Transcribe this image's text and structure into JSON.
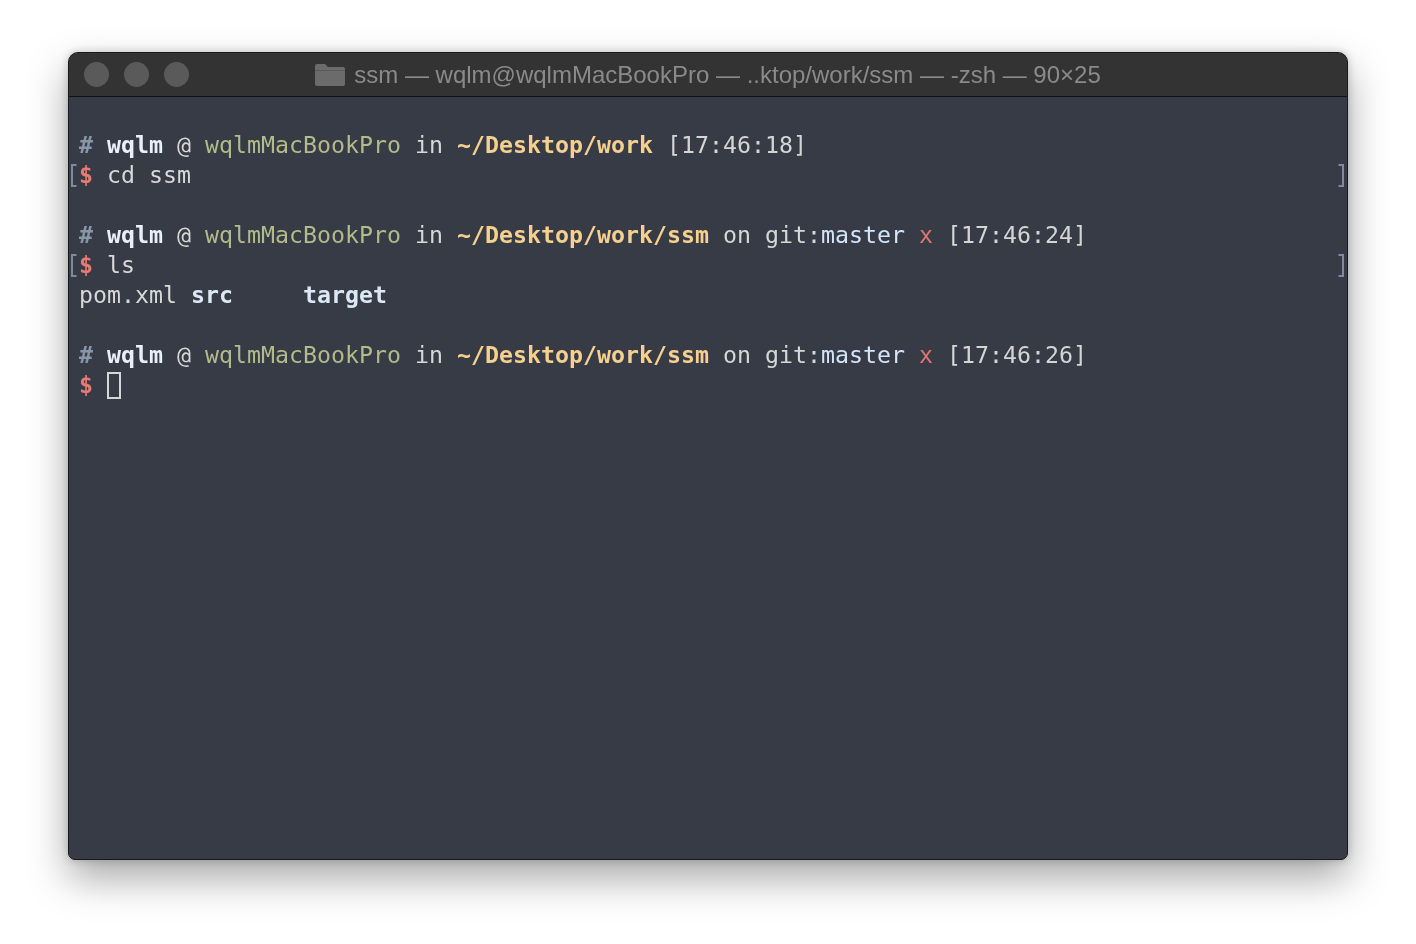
{
  "window": {
    "title": "ssm — wqlm@wqlmMacBookPro — ..ktop/work/ssm — -zsh — 90×25"
  },
  "terminal": {
    "blocks": [
      {
        "prompt": {
          "segments": [
            {
              "kind": "hash",
              "text": "#"
            },
            {
              "kind": "user",
              "text": "wqlm"
            },
            {
              "kind": "plain",
              "text": "@"
            },
            {
              "kind": "host",
              "text": "wqlmMacBookPro"
            },
            {
              "kind": "plain",
              "text": "in"
            },
            {
              "kind": "path",
              "text": "~/Desktop/work"
            },
            {
              "kind": "time",
              "text": "[17:46:18]"
            }
          ]
        },
        "command": {
          "marked": true,
          "symbol": "$",
          "text": "cd ssm",
          "cursor": false
        }
      },
      {
        "prompt": {
          "segments": [
            {
              "kind": "hash",
              "text": "#"
            },
            {
              "kind": "user",
              "text": "wqlm"
            },
            {
              "kind": "plain",
              "text": "@"
            },
            {
              "kind": "host",
              "text": "wqlmMacBookPro"
            },
            {
              "kind": "plain",
              "text": "in"
            },
            {
              "kind": "path",
              "text": "~/Desktop/work/ssm"
            },
            {
              "kind": "plain",
              "text": "on"
            },
            {
              "kind": "git",
              "label": "git:",
              "branch": "master"
            },
            {
              "kind": "dirty",
              "text": "x"
            },
            {
              "kind": "time",
              "text": "[17:46:24]"
            }
          ]
        },
        "command": {
          "marked": true,
          "symbol": "$",
          "text": "ls",
          "cursor": false
        },
        "output": {
          "entries": [
            {
              "kind": "file",
              "text": "pom.xml"
            },
            {
              "kind": "directory",
              "text": "src"
            },
            {
              "kind": "directory",
              "text": "target"
            }
          ]
        }
      },
      {
        "prompt": {
          "segments": [
            {
              "kind": "hash",
              "text": "#"
            },
            {
              "kind": "user",
              "text": "wqlm"
            },
            {
              "kind": "plain",
              "text": "@"
            },
            {
              "kind": "host",
              "text": "wqlmMacBookPro"
            },
            {
              "kind": "plain",
              "text": "in"
            },
            {
              "kind": "path",
              "text": "~/Desktop/work/ssm"
            },
            {
              "kind": "plain",
              "text": "on"
            },
            {
              "kind": "git",
              "label": "git:",
              "branch": "master"
            },
            {
              "kind": "dirty",
              "text": "x"
            },
            {
              "kind": "time",
              "text": "[17:46:26]"
            }
          ]
        },
        "command": {
          "marked": false,
          "symbol": "$",
          "cursor": true
        }
      }
    ]
  }
}
